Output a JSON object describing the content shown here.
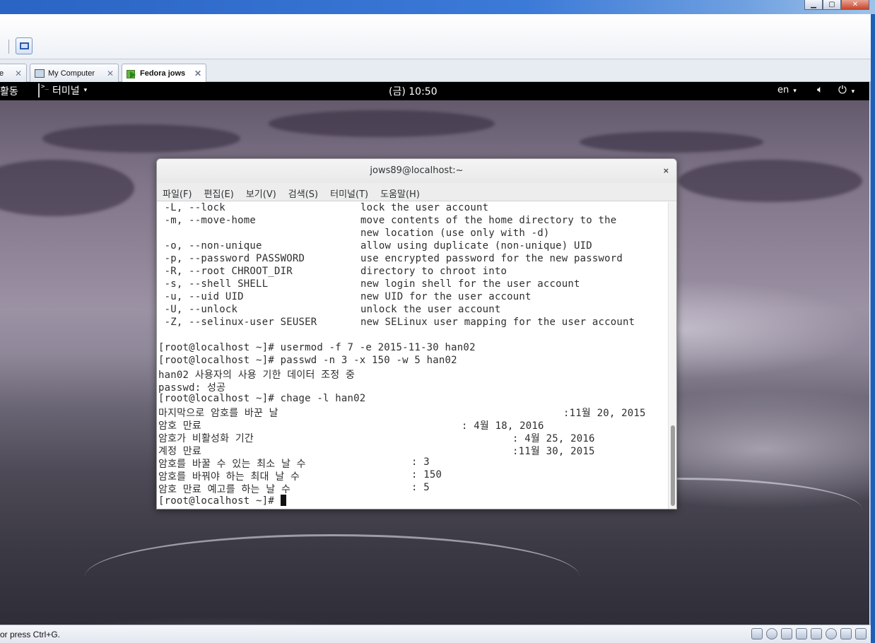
{
  "host": {
    "tabs": [
      {
        "label": "e",
        "active": false
      },
      {
        "label": "My Computer",
        "active": false
      },
      {
        "label": "Fedora jows",
        "active": true
      }
    ],
    "close_glyph": "✕",
    "status_text": "or press Ctrl+G."
  },
  "gnome": {
    "activities": "활동",
    "app_menu": "터미널",
    "clock": "(금) 10:50",
    "lang": "en",
    "caret": "▾"
  },
  "terminal": {
    "title": "jows89@localhost:~",
    "close_glyph": "×",
    "menu": [
      "파일(F)",
      "편집(E)",
      "보기(V)",
      "검색(S)",
      "터미널(T)",
      "도움말(H)"
    ],
    "help_lines": [
      {
        "opt": " -L, --lock",
        "desc": "lock the user account"
      },
      {
        "opt": " -m, --move-home",
        "desc": "move contents of the home directory to the"
      },
      {
        "opt": "",
        "desc": "new location (use only with -d)"
      },
      {
        "opt": " -o, --non-unique",
        "desc": "allow using duplicate (non-unique) UID"
      },
      {
        "opt": " -p, --password PASSWORD",
        "desc": "use encrypted password for the new password"
      },
      {
        "opt": " -R, --root CHROOT_DIR",
        "desc": "directory to chroot into"
      },
      {
        "opt": " -s, --shell SHELL",
        "desc": "new login shell for the user account"
      },
      {
        "opt": " -u, --uid UID",
        "desc": "new UID for the user account"
      },
      {
        "opt": " -U, --unlock",
        "desc": "unlock the user account"
      },
      {
        "opt": " -Z, --selinux-user SEUSER",
        "desc": "new SELinux user mapping for the user account"
      }
    ],
    "session_lines": [
      "[root@localhost ~]# usermod -f 7 -e 2015-11-30 han02",
      "[root@localhost ~]# passwd -n 3 -x 150 -w 5 han02",
      "han02 사용자의 사용 기한 데이터 조정 중",
      "passwd: 성공",
      "[root@localhost ~]# chage -l han02"
    ],
    "chage_rows": [
      {
        "label": "마지막으로 암호를 바꾼 날",
        "value": ":11월 20, 2015",
        "indent": 64
      },
      {
        "label": "암호 만료",
        "value": ": 4월 18, 2016",
        "indent": 48
      },
      {
        "label": "암호가 비활성화 기간",
        "value": ": 4월 25, 2016",
        "indent": 56
      },
      {
        "label": "계정 만료",
        "value": ":11월 30, 2015",
        "indent": 56
      },
      {
        "label": "암호를 바꿀 수 있는 최소 날 수",
        "value": ": 3",
        "indent": 40
      },
      {
        "label": "암호를 바꿔야 하는 최대 날 수",
        "value": ": 150",
        "indent": 40
      },
      {
        "label": "암호 만료 예고를 하는 날 수",
        "value": ": 5",
        "indent": 40
      }
    ],
    "prompt": "[root@localhost ~]# "
  }
}
